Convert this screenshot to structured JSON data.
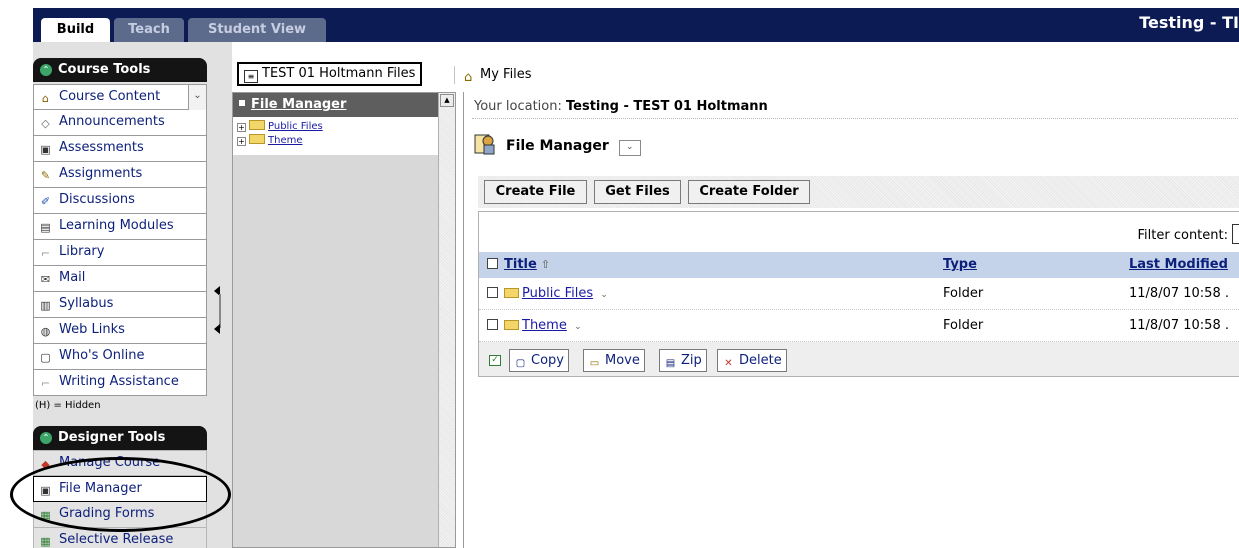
{
  "tabs": {
    "build": "Build",
    "teach": "Teach",
    "student_view": "Student View"
  },
  "course_title": "Testing - TI",
  "course_tools": {
    "header": "Course Tools",
    "items": [
      {
        "label": "Course Content",
        "icon": "house-icon"
      },
      {
        "label": "Announcements",
        "icon": "megaphone-icon"
      },
      {
        "label": "Assessments",
        "icon": "quiz-icon"
      },
      {
        "label": "Assignments",
        "icon": "assignment-icon"
      },
      {
        "label": "Discussions",
        "icon": "pushpin-icon"
      },
      {
        "label": "Learning Modules",
        "icon": "module-icon"
      },
      {
        "label": "Library",
        "icon": "library-icon"
      },
      {
        "label": "Mail",
        "icon": "mail-icon"
      },
      {
        "label": "Syllabus",
        "icon": "syllabus-icon"
      },
      {
        "label": "Web Links",
        "icon": "globe-icon"
      },
      {
        "label": "Who's Online",
        "icon": "monitor-icon"
      },
      {
        "label": "Writing Assistance",
        "icon": "writing-icon"
      }
    ],
    "hidden_note": "(H) = Hidden"
  },
  "designer_tools": {
    "header": "Designer Tools",
    "items": [
      {
        "label": "Manage Course",
        "icon": "cube-icon"
      },
      {
        "label": "File Manager",
        "icon": "file-manager-icon"
      },
      {
        "label": "Grading Forms",
        "icon": "grading-icon"
      },
      {
        "label": "Selective Release",
        "icon": "release-icon"
      }
    ]
  },
  "file_tabs": {
    "course_files": "TEST 01 Holtmann Files",
    "my_files": "My Files"
  },
  "tree": {
    "header": "File Manager",
    "nodes": [
      "Public Files",
      "Theme"
    ]
  },
  "main": {
    "location_label": "Your location:",
    "location_value": "Testing - TEST 01 Holtmann",
    "title": "File Manager",
    "actions": [
      "Create File",
      "Get Files",
      "Create Folder"
    ],
    "filter_label": "Filter content:",
    "columns": {
      "title": "Title",
      "type": "Type",
      "last_modified": "Last Modified"
    },
    "rows": [
      {
        "name": "Public Files",
        "type": "Folder",
        "modified": "11/8/07 10:58 ."
      },
      {
        "name": "Theme",
        "type": "Folder",
        "modified": "11/8/07 10:58 ."
      }
    ],
    "bulk_actions": [
      "Copy",
      "Move",
      "Zip",
      "Delete"
    ]
  },
  "colors": {
    "top_bar": "#0d1b55",
    "tool_header": "#141414",
    "column_header": "#c4d3ea",
    "link": "#1a1aa6"
  }
}
